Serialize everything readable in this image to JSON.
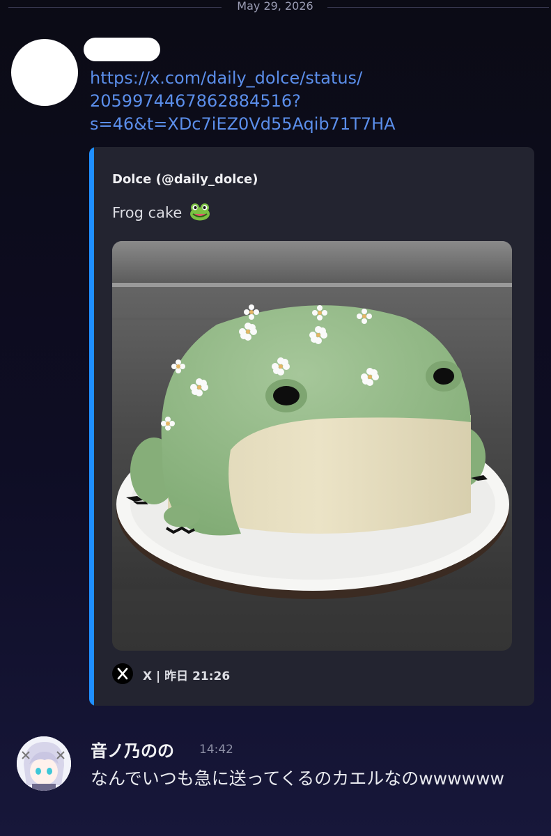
{
  "divider": {
    "date": "May 29, 2026"
  },
  "message1": {
    "link_lines": [
      "https://x.com/daily_dolce/status/",
      "2059974467862884516?",
      "s=46&t=XDc7iEZ0Vd55Aqib71T7HA"
    ],
    "embed": {
      "author": "Dolce (@daily_dolce)",
      "description": "Frog cake",
      "description_emoji": "frog-emoji",
      "image": "frog-shaped-cake-photo",
      "footer_icon": "x-logo-icon",
      "footer_text": "X | 昨日 21:26",
      "accent_color": "#1f8fff"
    }
  },
  "message2": {
    "username": "音ノ乃のの",
    "timestamp": "14:42",
    "text": "なんでいつも急に送ってくるのカエルなのwwwwww"
  }
}
